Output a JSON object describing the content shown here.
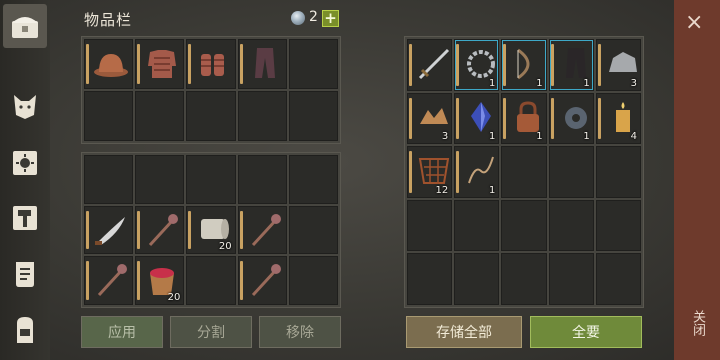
{
  "header": {
    "title": "物品栏",
    "currency_count": "2",
    "add_label": "+"
  },
  "tabs": [
    {
      "name": "chest"
    },
    {
      "name": "wolf"
    },
    {
      "name": "sun-book"
    },
    {
      "name": "hammer"
    },
    {
      "name": "scroll"
    },
    {
      "name": "backpack"
    }
  ],
  "equip_grid": [
    {
      "item": "leather-hat"
    },
    {
      "item": "chainmail-shirt"
    },
    {
      "item": "chain-gloves"
    },
    {
      "item": "leather-pants"
    },
    {
      "item": ""
    },
    {
      "item": ""
    },
    {
      "item": ""
    },
    {
      "item": ""
    },
    {
      "item": ""
    },
    {
      "item": ""
    }
  ],
  "inventory_grid": [
    {
      "item": ""
    },
    {
      "item": ""
    },
    {
      "item": ""
    },
    {
      "item": ""
    },
    {
      "item": ""
    },
    {
      "item": "scimitar",
      "qty": ""
    },
    {
      "item": "mace",
      "qty": ""
    },
    {
      "item": "cloth-roll",
      "qty": "20"
    },
    {
      "item": "mace",
      "qty": ""
    },
    {
      "item": ""
    },
    {
      "item": "mace",
      "qty": ""
    },
    {
      "item": "berry-bucket",
      "qty": "20"
    },
    {
      "item": ""
    },
    {
      "item": "mace",
      "qty": ""
    },
    {
      "item": ""
    }
  ],
  "storage_grid": [
    {
      "item": "sword",
      "qty": ""
    },
    {
      "item": "chain-coil",
      "qty": "1"
    },
    {
      "item": "recurve-bow",
      "qty": "1"
    },
    {
      "item": "dark-pants",
      "qty": "1"
    },
    {
      "item": "stone-ore",
      "qty": "3"
    },
    {
      "item": "wood-chips",
      "qty": "3"
    },
    {
      "item": "crystal",
      "qty": "1"
    },
    {
      "item": "padlock",
      "qty": "1"
    },
    {
      "item": "gear-part",
      "qty": "1"
    },
    {
      "item": "candle",
      "qty": "4"
    },
    {
      "item": "rope-net",
      "qty": "12"
    },
    {
      "item": "rope",
      "qty": "1"
    },
    {
      "item": ""
    },
    {
      "item": ""
    },
    {
      "item": ""
    },
    {
      "item": ""
    },
    {
      "item": ""
    },
    {
      "item": ""
    },
    {
      "item": ""
    },
    {
      "item": ""
    },
    {
      "item": ""
    },
    {
      "item": ""
    },
    {
      "item": ""
    },
    {
      "item": ""
    },
    {
      "item": ""
    }
  ],
  "buttons": {
    "apply": "应用",
    "split": "分割",
    "remove": "移除",
    "store_all": "存储全部",
    "take_all": "全要"
  },
  "close": {
    "x": "×",
    "label": "关闭"
  },
  "colors": {
    "accent_green": "#6f8a3a",
    "close_red": "#6e3a2c",
    "slot_bg": "#2b2b28"
  }
}
